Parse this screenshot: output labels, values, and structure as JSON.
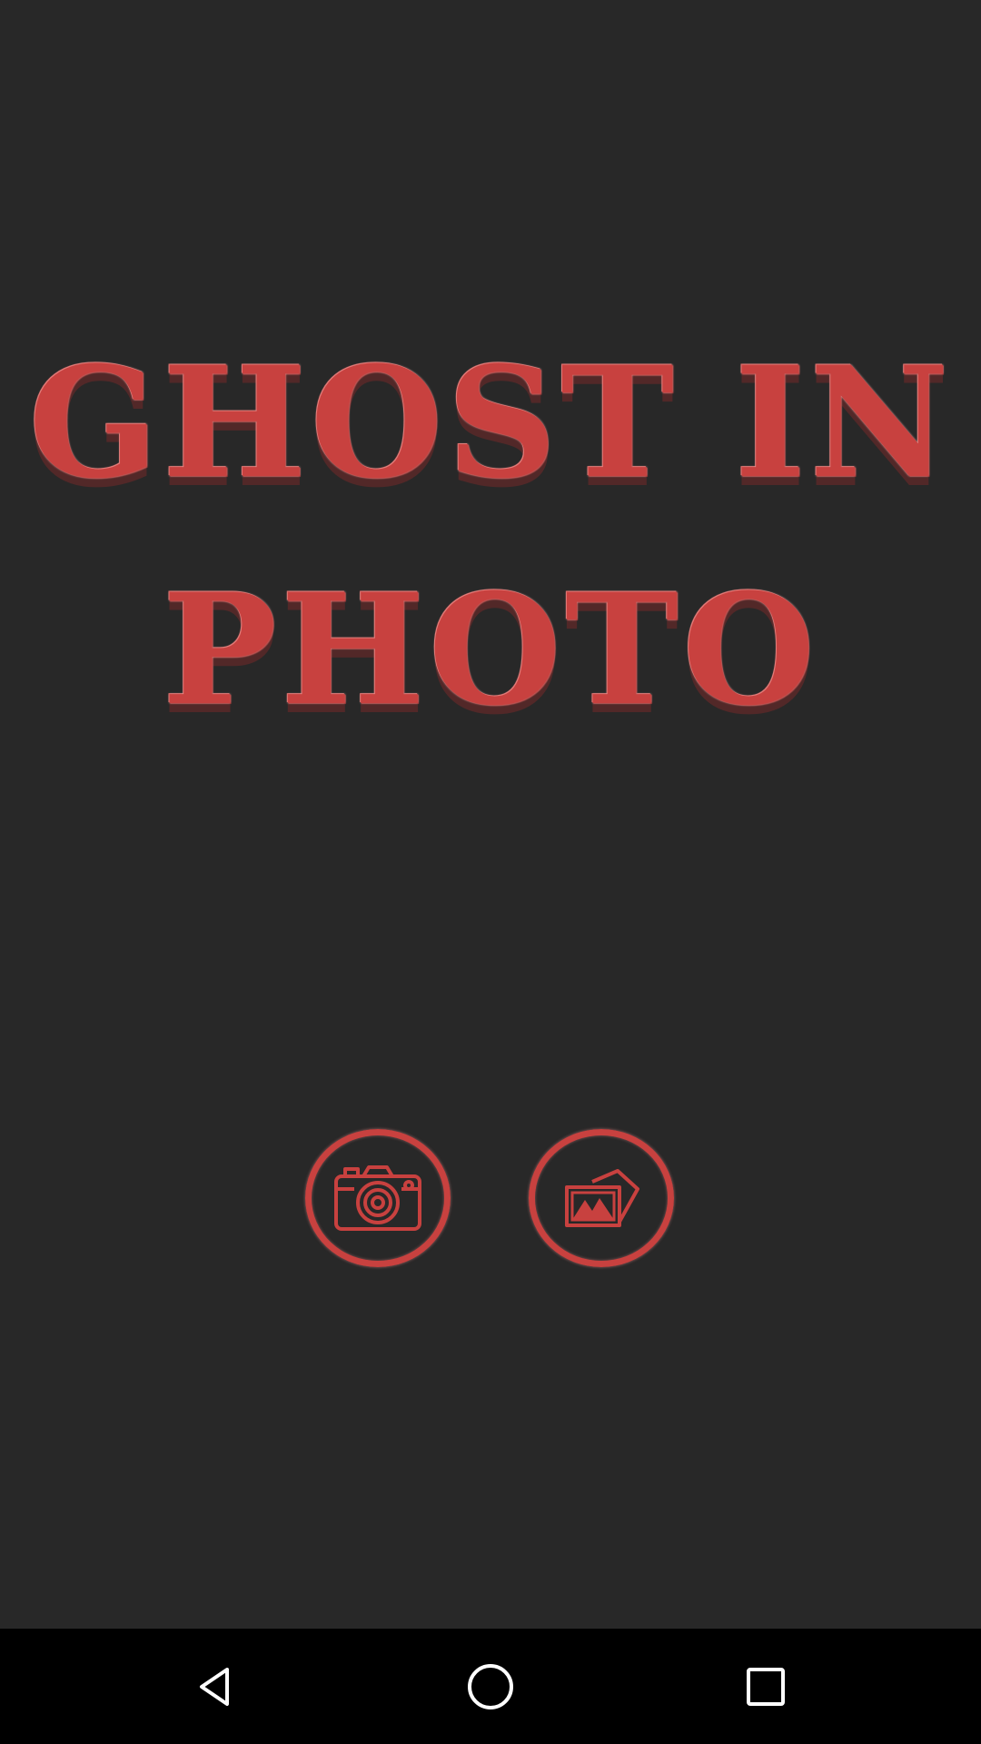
{
  "app": {
    "title_line1": "GHOST IN",
    "title_line2": "PHOTO",
    "accent_color": "#c8413f",
    "background_color": "#282828"
  },
  "actions": {
    "camera": {
      "icon": "camera-icon"
    },
    "gallery": {
      "icon": "gallery-icon"
    }
  },
  "navigation_bar": {
    "back": {
      "icon": "back-triangle-icon"
    },
    "home": {
      "icon": "home-circle-icon"
    },
    "recents": {
      "icon": "recents-square-icon"
    }
  }
}
